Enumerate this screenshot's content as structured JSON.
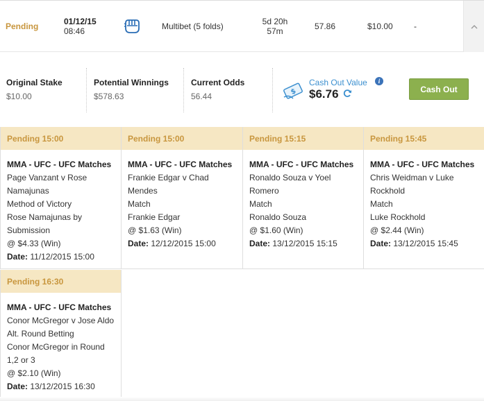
{
  "bet_row": {
    "status": "Pending",
    "date": "01/12/15",
    "time": "08:46",
    "icon": "fist-icon",
    "bet_type": "Multibet (5 folds)",
    "time_left_line1": "5d 20h",
    "time_left_line2": "57m",
    "odds": "57.86",
    "stake": "$10.00",
    "return": "-",
    "collapse_icon": "chevron-up-icon"
  },
  "summary": {
    "original_stake_label": "Original Stake",
    "original_stake_value": "$10.00",
    "potential_winnings_label": "Potential Winnings",
    "potential_winnings_value": "$578.63",
    "current_odds_label": "Current Odds",
    "current_odds_value": "56.44",
    "cash_out_value_label": "Cash Out Value",
    "cash_out_value": "$6.76",
    "cash_out_button": "Cash Out",
    "info_icon": "i"
  },
  "legs": [
    {
      "header": "Pending 15:00",
      "market": "MMA - UFC - UFC Matches",
      "lines": [
        "Page Vanzant v Rose",
        "Namajunas",
        "Method of Victory",
        "Rose Namajunas by",
        "Submission",
        "@ $4.33 (Win)"
      ],
      "date_label": "Date:",
      "date": "11/12/2015 15:00"
    },
    {
      "header": "Pending 15:00",
      "market": "MMA - UFC - UFC Matches",
      "lines": [
        "Frankie Edgar v Chad",
        "Mendes",
        "Match",
        "Frankie Edgar",
        "@ $1.63 (Win)"
      ],
      "date_label": "Date:",
      "date": "12/12/2015 15:00"
    },
    {
      "header": "Pending 15:15",
      "market": "MMA - UFC - UFC Matches",
      "lines": [
        "Ronaldo Souza v Yoel",
        "Romero",
        "Match",
        "Ronaldo Souza",
        "@ $1.60 (Win)"
      ],
      "date_label": "Date:",
      "date": "13/12/2015 15:15"
    },
    {
      "header": "Pending 15:45",
      "market": "MMA - UFC - UFC Matches",
      "lines": [
        "Chris Weidman v Luke",
        "Rockhold",
        "Match",
        "Luke Rockhold",
        "@ $2.44 (Win)"
      ],
      "date_label": "Date:",
      "date": "13/12/2015 15:45"
    },
    {
      "header": "Pending 16:30",
      "market": "MMA - UFC - UFC Matches",
      "lines": [
        "Conor McGregor v Jose Aldo",
        "Alt. Round Betting",
        "Conor McGregor in Round",
        "1,2 or 3",
        "@ $2.10 (Win)"
      ],
      "date_label": "Date:",
      "date": "13/12/2015 16:30"
    }
  ],
  "colors": {
    "pending": "#c8963e",
    "leg_header_bg": "#f6e7c3",
    "cash_out_button": "#8cb04e",
    "link_blue": "#3b8fcf"
  }
}
